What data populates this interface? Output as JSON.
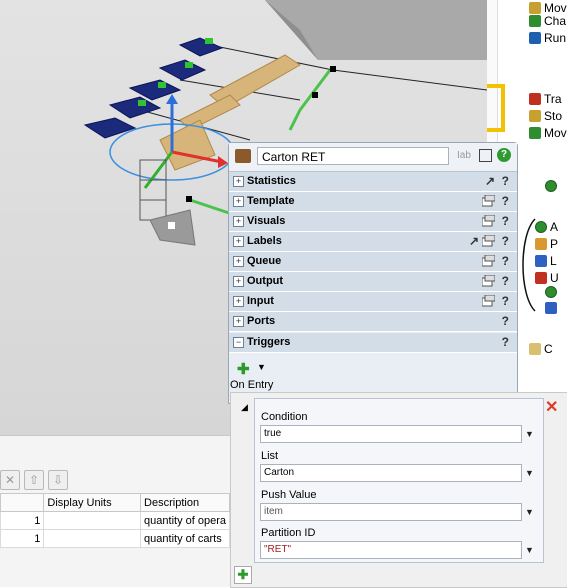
{
  "library": {
    "items_top": [
      {
        "label": "Mov",
        "icon": "move-icon",
        "color": "#c8a030"
      },
      {
        "label": "Cha",
        "icon": "change-icon",
        "color": "#2f8d2f"
      },
      {
        "label": "Run",
        "icon": "run-icon",
        "color": "#1f5fb0"
      }
    ],
    "items_mid": [
      {
        "label": "Tra",
        "icon": "transport-icon",
        "color": "#c03020"
      },
      {
        "label": "Sto",
        "icon": "storage-icon",
        "color": "#c8a030"
      },
      {
        "label": "Mov",
        "icon": "move-icon",
        "color": "#2f8d2f"
      }
    ],
    "items_right": [
      {
        "label": "A",
        "icon": "activity-icon"
      },
      {
        "label": "P",
        "icon": "pull-icon"
      },
      {
        "label": "L",
        "icon": "load-icon"
      },
      {
        "label": "U",
        "icon": "unload-icon"
      }
    ],
    "bottom_item": {
      "label": "C",
      "icon": "storage-icon"
    }
  },
  "table": {
    "toolbar": {
      "delete": "✕",
      "up": "⇧",
      "down": "⇩"
    },
    "columns": [
      "",
      "Display Units",
      "Description"
    ],
    "rows": [
      {
        "value": "1",
        "units": "",
        "description": "quantity of opera"
      },
      {
        "value": "1",
        "units": "",
        "description": "quantity of carts"
      }
    ]
  },
  "properties": {
    "object_name": "Carton RET",
    "sections": [
      {
        "label": "Statistics"
      },
      {
        "label": "Template"
      },
      {
        "label": "Visuals"
      },
      {
        "label": "Labels"
      },
      {
        "label": "Queue"
      },
      {
        "label": "Output"
      },
      {
        "label": "Input"
      },
      {
        "label": "Ports"
      }
    ],
    "triggers": {
      "label": "Triggers",
      "event": "On Entry",
      "fields": [
        {
          "label": "Condition",
          "value": "true",
          "color": "#000000"
        },
        {
          "label": "List",
          "value": "Carton",
          "color": "#000000"
        },
        {
          "label": "Push Value",
          "value": "item",
          "color": "#555555"
        },
        {
          "label": "Partition ID",
          "value": "\"RET\"",
          "color": "#a0202a"
        }
      ]
    }
  }
}
